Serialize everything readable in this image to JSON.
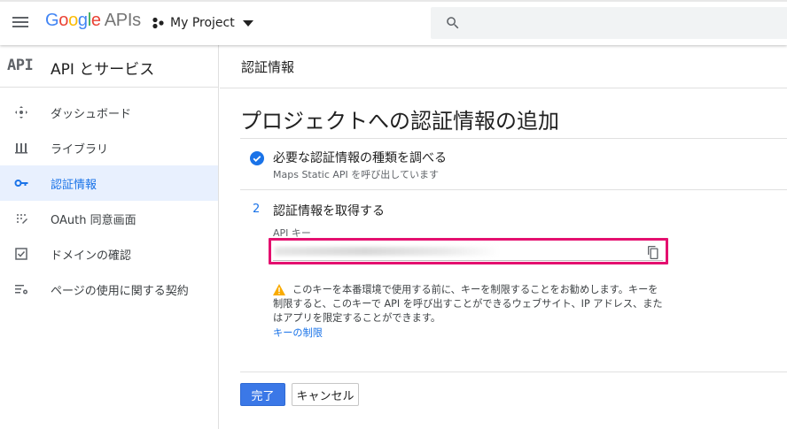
{
  "header": {
    "logo_google": "Google",
    "logo_apis": "APIs",
    "project_name": "My Project",
    "icons": [
      "menu-icon",
      "project-dots-icon",
      "caret-down-icon",
      "search-icon"
    ]
  },
  "sidebar": {
    "api_mark": "API",
    "title": "API とサービス",
    "items": [
      {
        "label": "ダッシュボード",
        "icon": "dashboard-icon",
        "active": false
      },
      {
        "label": "ライブラリ",
        "icon": "library-icon",
        "active": false
      },
      {
        "label": "認証情報",
        "icon": "key-icon",
        "active": true
      },
      {
        "label": "OAuth 同意画面",
        "icon": "oauth-icon",
        "active": false
      },
      {
        "label": "ドメインの確認",
        "icon": "checkbox-icon",
        "active": false
      },
      {
        "label": "ページの使用に関する契約",
        "icon": "settings-list-icon",
        "active": false
      }
    ]
  },
  "main": {
    "breadcrumb": "認証情報",
    "page_title": "プロジェクトへの認証情報の追加",
    "step1": {
      "title": "必要な認証情報の種類を調べる",
      "subtitle": "Maps Static API を呼び出しています"
    },
    "step2": {
      "number": "2",
      "title": "認証情報を取得する",
      "key_label": "API キー"
    },
    "warning": {
      "text": "このキーを本番環境で使用する前に、キーを制限することをお勧めします。キーを制限すると、このキーで API を呼び出すことができるウェブサイト、IP アドレス、またはアプリを限定することができます。",
      "link": "キーの制限"
    },
    "buttons": {
      "done": "完了",
      "cancel": "キャンセル"
    }
  },
  "colors": {
    "accent": "#1a73e8",
    "primary_button": "#3b78e7",
    "highlight": "#e4106f",
    "warning": "#f9ab00",
    "active_bg": "#e8f0fe"
  }
}
